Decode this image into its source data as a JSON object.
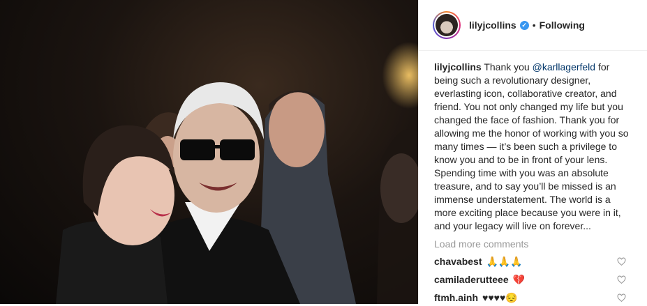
{
  "post": {
    "username": "lilyjcollins",
    "verified_badge": "verified-check-icon",
    "separator": "•",
    "follow_status": "Following"
  },
  "caption": {
    "username": "lilyjcollins",
    "text_before": "Thank you ",
    "mention": "@karllagerfeld",
    "text_after": " for being such a revolutionary designer, everlasting icon, collaborative creator, and friend. You not only changed my life but you changed the face of fashion. Thank you for allowing me the honor of working with you so many times — it’s been such a privilege to know you and to be in front of your lens. Spending time with you was an absolute treasure, and to say you’ll be missed is an immense understatement. The world is a more exciting place because you were in it, and your legacy will live on forever..."
  },
  "load_more": "Load more comments",
  "comments": [
    {
      "username": "chavabest",
      "text": "🙏🙏🙏"
    },
    {
      "username": "camiladerutteee",
      "text": "💔"
    },
    {
      "username": "ftmh.ainh",
      "text": "♥♥♥♥😔"
    }
  ],
  "colors": {
    "verified": "#3897f0",
    "mention": "#003569",
    "muted": "#999999",
    "text": "#262626"
  }
}
